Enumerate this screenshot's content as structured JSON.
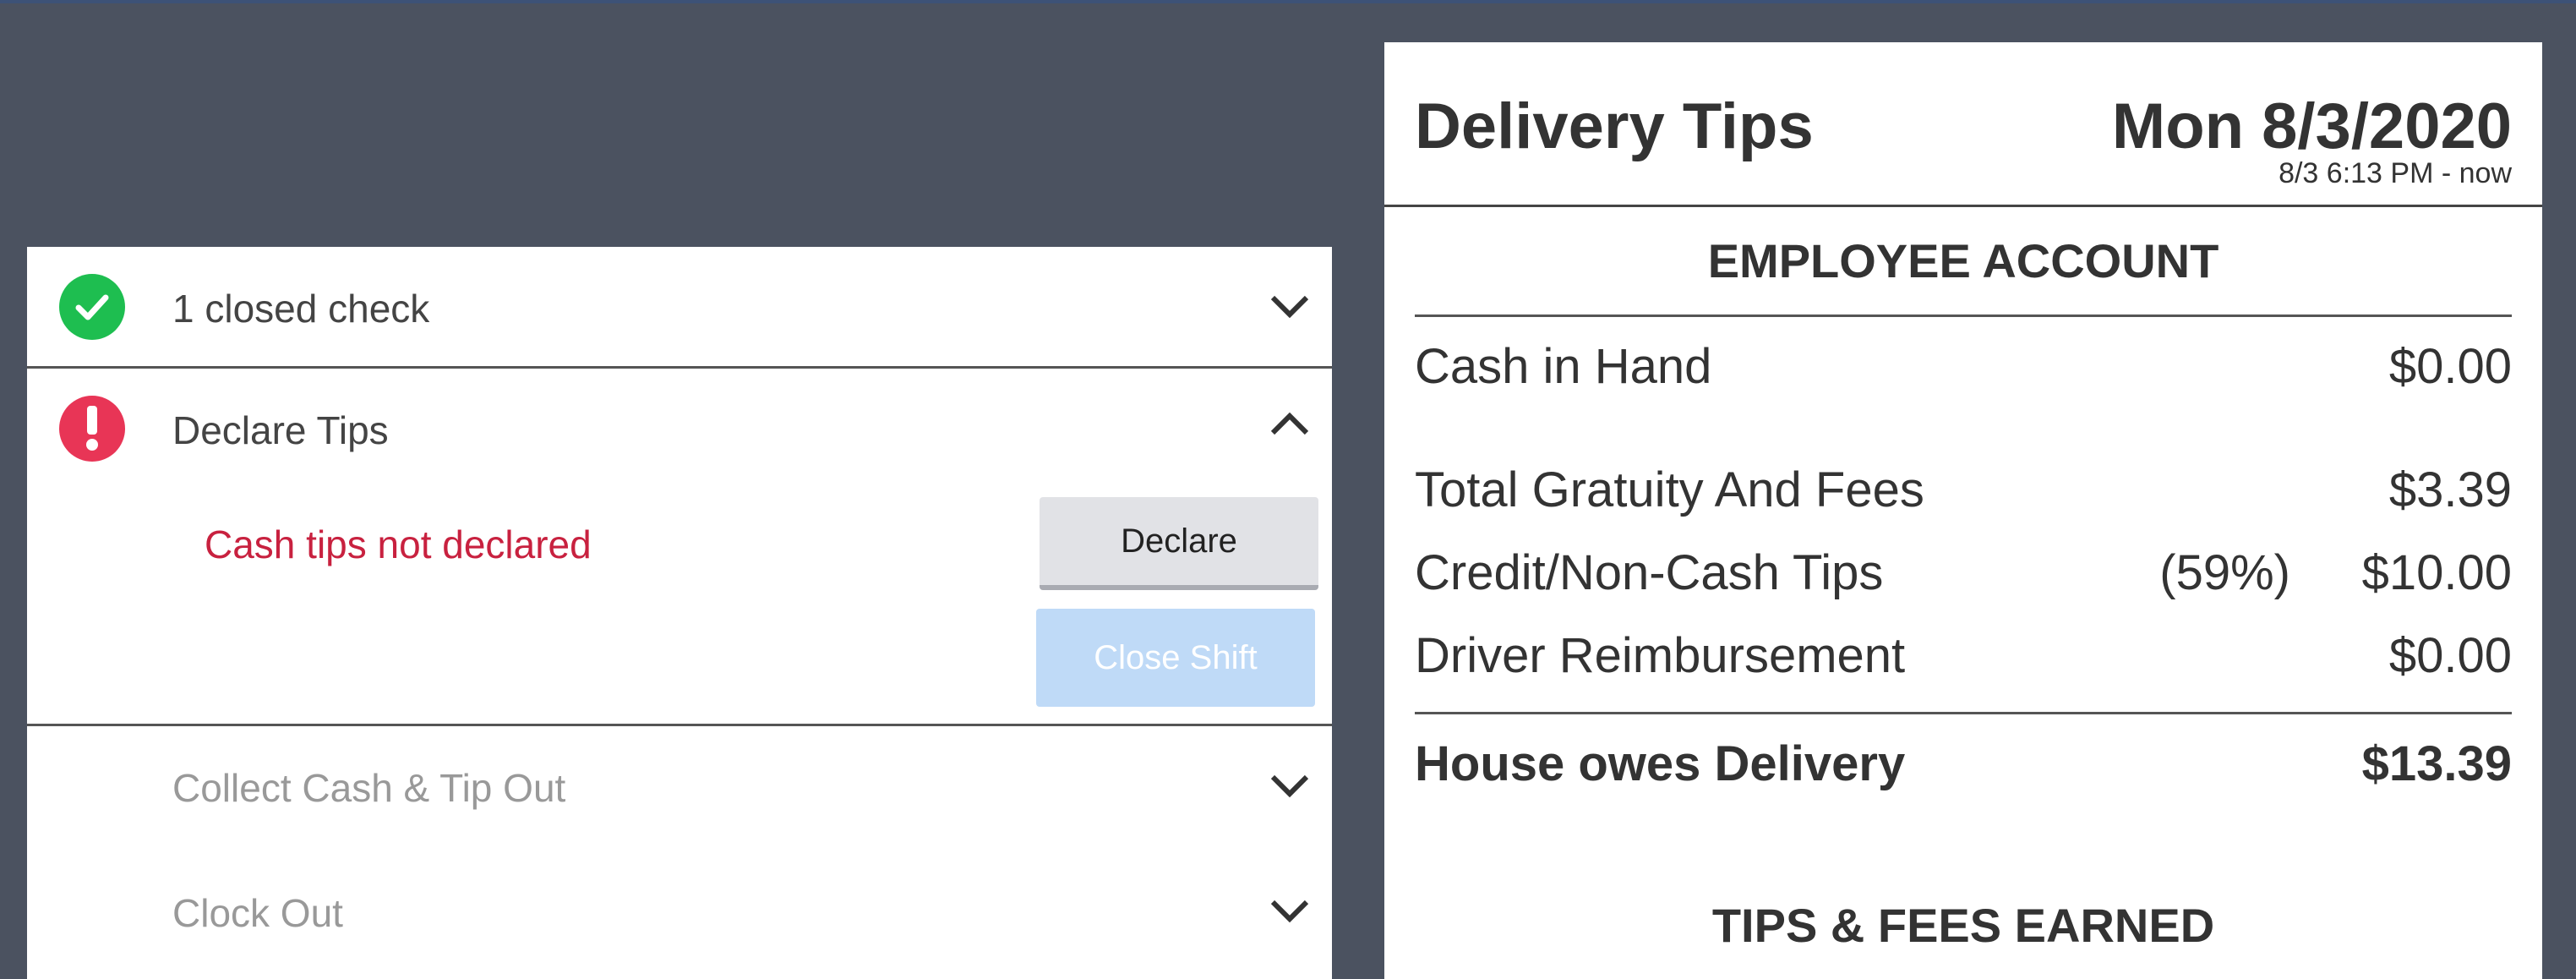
{
  "checklist": {
    "closed_checks": {
      "label": "1 closed check",
      "status": "complete"
    },
    "declare_tips": {
      "label": "Declare Tips",
      "status": "error",
      "warning": "Cash tips not declared",
      "declare_button": "Declare",
      "close_shift_button": "Close Shift"
    },
    "collect_cash": {
      "label": "Collect Cash & Tip Out"
    },
    "clock_out": {
      "label": "Clock Out"
    }
  },
  "summary": {
    "title": "Delivery Tips",
    "date": "Mon 8/3/2020",
    "time_range": "8/3 6:13 PM - now",
    "employee_account": {
      "heading": "EMPLOYEE ACCOUNT",
      "cash_in_hand": {
        "label": "Cash in Hand",
        "value": "$0.00"
      },
      "items": [
        {
          "label": "Total Gratuity And Fees",
          "percent": "",
          "value": "$3.39"
        },
        {
          "label": "Credit/Non-Cash Tips",
          "percent": "(59%)",
          "value": "$10.00"
        },
        {
          "label": "Driver Reimbursement",
          "percent": "",
          "value": "$0.00"
        }
      ],
      "total": {
        "label": "House owes Delivery",
        "value": "$13.39"
      }
    },
    "tips_heading": "TIPS & FEES EARNED"
  },
  "colors": {
    "background": "#4b5260",
    "success": "#1ebe50",
    "error": "#e83556",
    "warning_text": "#c8213f",
    "disabled_button": "#bfdaf7"
  }
}
